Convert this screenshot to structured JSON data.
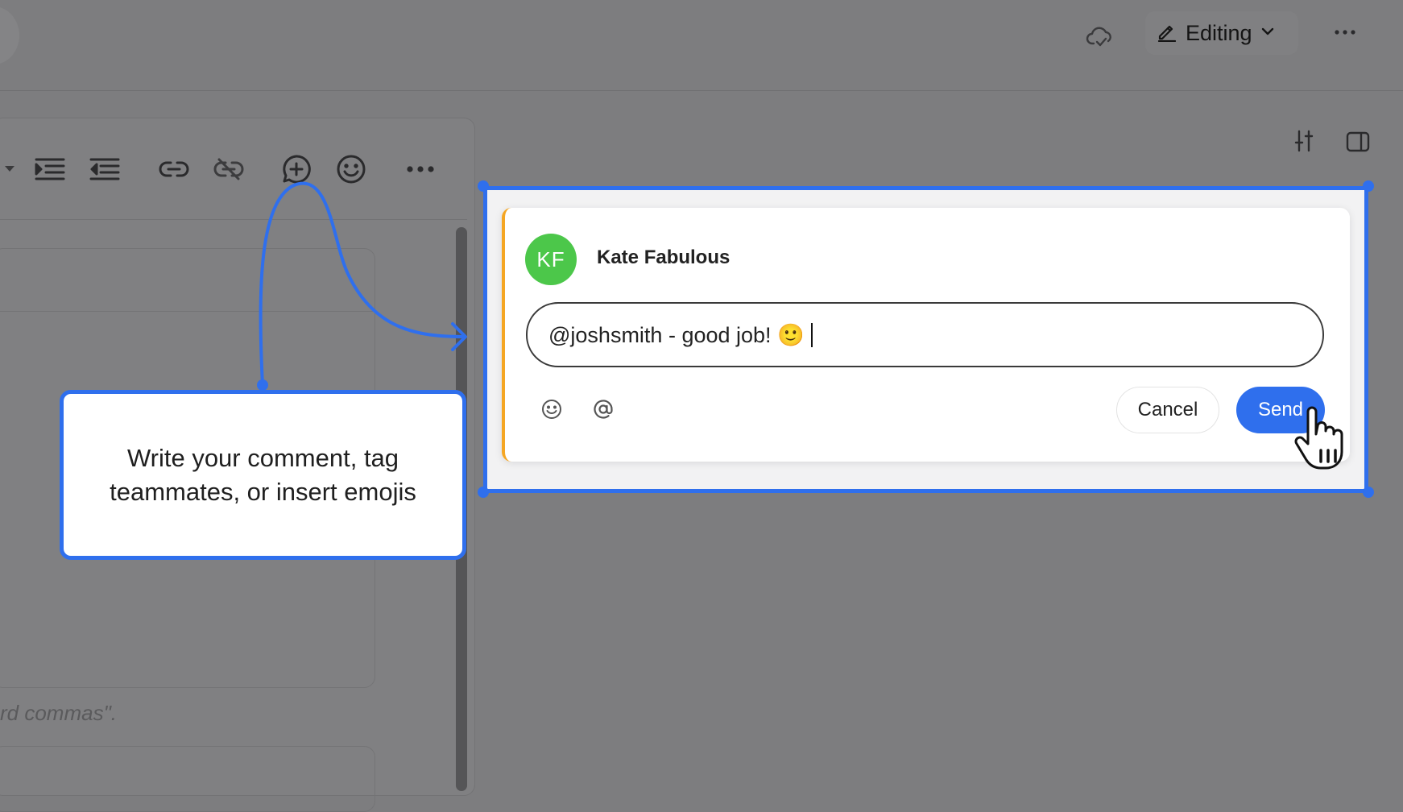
{
  "header": {
    "mode_label": "Editing",
    "icons": [
      "cloud-sync-icon",
      "pencil-icon",
      "chevron-down-icon",
      "more-horizontal-icon"
    ]
  },
  "side_panel": {
    "icons": [
      "sliders-icon",
      "panel-toggle-icon"
    ]
  },
  "editor": {
    "toolbar_icons": [
      "dropdown-caret-icon",
      "indent-icon",
      "outdent-icon",
      "link-icon",
      "unlink-icon",
      "add-comment-icon",
      "emoji-icon",
      "more-horizontal-icon"
    ],
    "hint_fragment": "rd commas\"."
  },
  "comment": {
    "avatar_initials": "KF",
    "author": "Kate Fabulous",
    "input_value": "@joshsmith - good job! 🙂",
    "cancel_label": "Cancel",
    "send_label": "Send",
    "icons": [
      "emoji-icon",
      "at-mention-icon"
    ]
  },
  "callout": {
    "text": "Write your comment, tag teammates, or insert emojis"
  },
  "colors": {
    "background": "#7d7d7f",
    "accent": "#2f6fed",
    "avatar": "#4cc74a",
    "card_border": "#f5a623"
  }
}
